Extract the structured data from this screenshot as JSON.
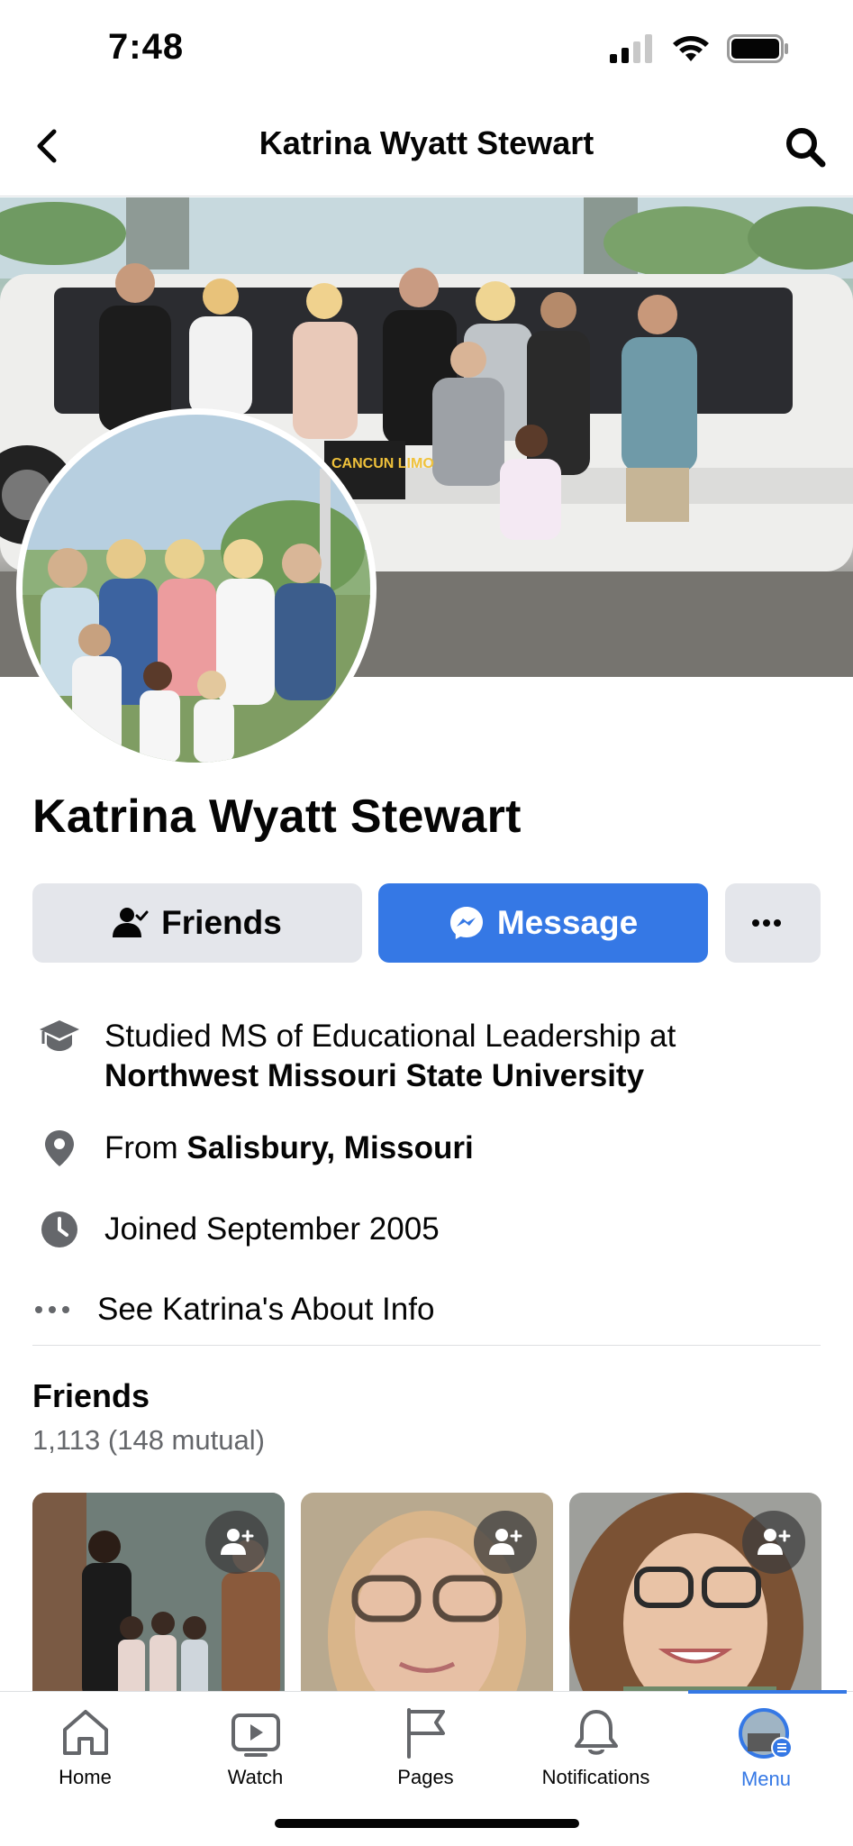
{
  "status_bar": {
    "time": "7:48"
  },
  "header": {
    "title": "Katrina Wyatt Stewart"
  },
  "profile": {
    "name": "Katrina Wyatt Stewart",
    "friends_button": "Friends",
    "message_button": "Message",
    "more_button": "···"
  },
  "intro": {
    "education_prefix": "Studied MS of Educational Leadership at",
    "education_school": "Northwest Missouri State University",
    "hometown_prefix": "From",
    "hometown": "Salisbury, Missouri",
    "joined": "Joined September 2005",
    "about_link": "See Katrina's About Info"
  },
  "friends": {
    "title": "Friends",
    "count": "1,113 (148 mutual)"
  },
  "tabs": [
    {
      "label": "Home",
      "icon": "home-icon"
    },
    {
      "label": "Watch",
      "icon": "watch-icon"
    },
    {
      "label": "Pages",
      "icon": "flag-icon"
    },
    {
      "label": "Notifications",
      "icon": "bell-icon"
    },
    {
      "label": "Menu",
      "icon": "menu-avatar-icon",
      "active": true
    }
  ],
  "colors": {
    "accent": "#3578e5",
    "secondary_button": "#e4e6eb",
    "muted_text": "#65676b"
  }
}
